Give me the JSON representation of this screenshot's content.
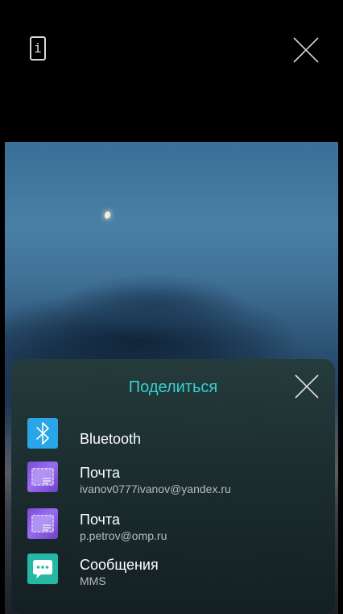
{
  "toolbar": {
    "info_glyph": "i"
  },
  "share_sheet": {
    "title": "Поделиться",
    "items": [
      {
        "icon": "bluetooth-icon",
        "title": "Bluetooth",
        "subtitle": ""
      },
      {
        "icon": "mail-icon",
        "title": "Почта",
        "subtitle": "ivanov0777ivanov@yandex.ru"
      },
      {
        "icon": "mail-icon",
        "title": "Почта",
        "subtitle": "p.petrov@omp.ru"
      },
      {
        "icon": "messages-icon",
        "title": "Сообщения",
        "subtitle": "MMS"
      }
    ]
  },
  "colors": {
    "accent": "#37d0cf",
    "bluetooth": "#2aa5e8",
    "mail": "#8a5ce6",
    "messages": "#25b8a4"
  }
}
